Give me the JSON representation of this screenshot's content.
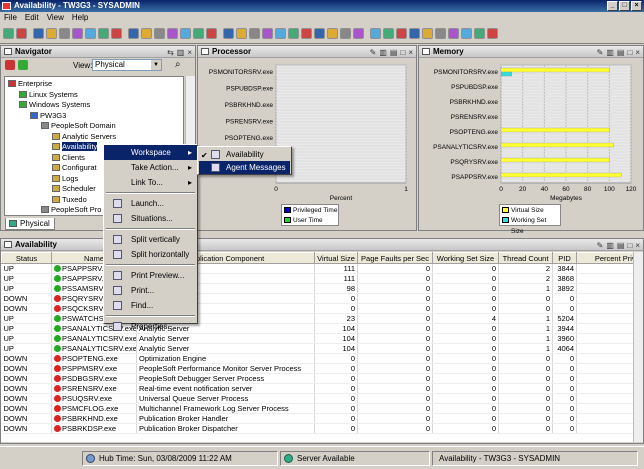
{
  "window": {
    "title": "Availability - TW3G3 - SYSADMIN"
  },
  "menubar": [
    "File",
    "Edit",
    "View",
    "Help"
  ],
  "navigator": {
    "title": "Navigator",
    "view_label": "View:",
    "view_value": "Physical",
    "tree": [
      {
        "label": "Enterprise",
        "level": 0
      },
      {
        "label": "Linux Systems",
        "level": 1
      },
      {
        "label": "Windows Systems",
        "level": 1
      },
      {
        "label": "PW3G3",
        "level": 2
      },
      {
        "label": "PeopleSoft Domain",
        "level": 3
      },
      {
        "label": "Analytic Servers",
        "level": 4
      },
      {
        "label": "Availability",
        "level": 4,
        "selected": true
      },
      {
        "label": "Clients",
        "level": 4
      },
      {
        "label": "Configurat",
        "level": 4
      },
      {
        "label": "Logs",
        "level": 4
      },
      {
        "label": "Scheduler",
        "level": 4
      },
      {
        "label": "Tuxedo",
        "level": 4
      },
      {
        "label": "PeopleSoft Pro",
        "level": 3
      }
    ],
    "tab": "Physical"
  },
  "processor": {
    "title": "Processor",
    "legend": [
      "Privileged Time",
      "User Time"
    ],
    "colors": {
      "privileged": "#0000cc",
      "user": "#33cc33"
    }
  },
  "memory": {
    "title": "Memory",
    "legend": [
      "Virtual Size",
      "Working Set Size"
    ],
    "colors": {
      "virtual": "#ffff33",
      "working": "#33dddd"
    }
  },
  "chart_data": [
    {
      "type": "bar",
      "title": "Processor",
      "orientation": "horizontal",
      "categories": [
        "PSMONITORSRV.exe",
        "PSPUBDSP.exe",
        "PSBRKHND.exe",
        "PSRENSRV.exe",
        "PSOPTENG.exe",
        "PSANALYTICSRV.exe"
      ],
      "series": [
        {
          "name": "Privileged Time",
          "values": [
            0,
            0,
            0,
            0,
            0,
            0
          ]
        },
        {
          "name": "User Time",
          "values": [
            0,
            0,
            0,
            0,
            0,
            0
          ]
        }
      ],
      "xlabel": "Percent",
      "xticks": [
        "0",
        "1"
      ],
      "xlim": [
        0,
        1
      ]
    },
    {
      "type": "bar",
      "title": "Memory",
      "orientation": "horizontal",
      "categories": [
        "PSMONITORSRV.exe",
        "PSPUBDSP.exe",
        "PSBRKHND.exe",
        "PSRENSRV.exe",
        "PSOPTENG.exe",
        "PSANALYTICSRV.exe",
        "PSQRYSRV.exe",
        "PSAPPSRV.exe"
      ],
      "series": [
        {
          "name": "Virtual Size",
          "values": [
            100,
            0,
            0,
            0,
            100,
            104,
            100,
            111
          ]
        },
        {
          "name": "Working Set Size",
          "values": [
            10,
            0,
            0,
            0,
            0,
            0,
            0,
            0
          ]
        }
      ],
      "xlabel": "Megabytes",
      "xticks": [
        "0",
        "20",
        "40",
        "60",
        "80",
        "100",
        "120"
      ],
      "xlim": [
        0,
        120
      ]
    }
  ],
  "context_menu": {
    "items": [
      "Workspace",
      "Take Action...",
      "Link To...",
      "Launch...",
      "Situations...",
      "Split vertically",
      "Split horizontally",
      "Print Preview...",
      "Print...",
      "Find...",
      "Properties..."
    ]
  },
  "submenu": {
    "items": [
      "Availability",
      "Agent Messages"
    ]
  },
  "availability": {
    "title": "Availability",
    "columns": [
      "Status",
      "Name",
      "Application Component",
      "Virtual Size",
      "Page Faults per Sec",
      "Working Set Size",
      "Thread Count",
      "PID",
      "Percent Privile"
    ],
    "rows": [
      [
        "UP",
        "PSAPPSRV.exe",
        "",
        "111",
        "0",
        "0",
        "2",
        "3844",
        ""
      ],
      [
        "UP",
        "PSAPPSRV.exe",
        "",
        "111",
        "0",
        "0",
        "2",
        "3868",
        ""
      ],
      [
        "UP",
        "PSSAMSRV.exe",
        "ager",
        "98",
        "0",
        "0",
        "1",
        "3892",
        ""
      ],
      [
        "DOWN",
        "PSQRYSRV.exe",
        "",
        "0",
        "0",
        "0",
        "0",
        "0",
        ""
      ],
      [
        "DOWN",
        "PSQCKSRV.exe",
        "",
        "0",
        "0",
        "0",
        "0",
        "0",
        ""
      ],
      [
        "UP",
        "PSWATCHSRV",
        "",
        "23",
        "0",
        "4",
        "1",
        "5204",
        ""
      ],
      [
        "UP",
        "PSANALYTICSRV.exe",
        "Analytic Server",
        "104",
        "0",
        "0",
        "1",
        "3944",
        ""
      ],
      [
        "UP",
        "PSANALYTICSRV.exe",
        "Analytic Server",
        "104",
        "0",
        "0",
        "1",
        "3960",
        ""
      ],
      [
        "UP",
        "PSANALYTICSRV.exe",
        "Analytic Server",
        "104",
        "0",
        "0",
        "1",
        "4064",
        ""
      ],
      [
        "DOWN",
        "PSOPTENG.exe",
        "Optimization Engine",
        "0",
        "0",
        "0",
        "0",
        "0",
        ""
      ],
      [
        "DOWN",
        "PSPPMSRV.exe",
        "PeopleSoft Performance Monitor Server Process",
        "0",
        "0",
        "0",
        "0",
        "0",
        ""
      ],
      [
        "DOWN",
        "PSDBGSRV.exe",
        "PeopleSoft Debugger Server Process",
        "0",
        "0",
        "0",
        "0",
        "0",
        ""
      ],
      [
        "DOWN",
        "PSRENSRV.exe",
        "Real-time event notification server",
        "0",
        "0",
        "0",
        "0",
        "0",
        ""
      ],
      [
        "DOWN",
        "PSUQSRV.exe",
        "Universal Queue Server Process",
        "0",
        "0",
        "0",
        "0",
        "0",
        ""
      ],
      [
        "DOWN",
        "PSMCFLOG.exe",
        "Multichannel Framework Log Server Process",
        "0",
        "0",
        "0",
        "0",
        "0",
        ""
      ],
      [
        "DOWN",
        "PSBRKHND.exe",
        "Publication Broker Handler",
        "0",
        "0",
        "0",
        "0",
        "0",
        ""
      ],
      [
        "DOWN",
        "PSBRKDSP.exe",
        "Publication Broker Dispatcher",
        "0",
        "0",
        "0",
        "0",
        "0",
        ""
      ]
    ]
  },
  "statusbar": {
    "hub_time": "Hub Time: Sun, 03/08/2009 11:22 AM",
    "server": "Server Available",
    "workspace": "Availability - TW3G3 - SYSADMIN"
  },
  "status_colors": {
    "up": "#22aa22",
    "down": "#dd2222"
  }
}
